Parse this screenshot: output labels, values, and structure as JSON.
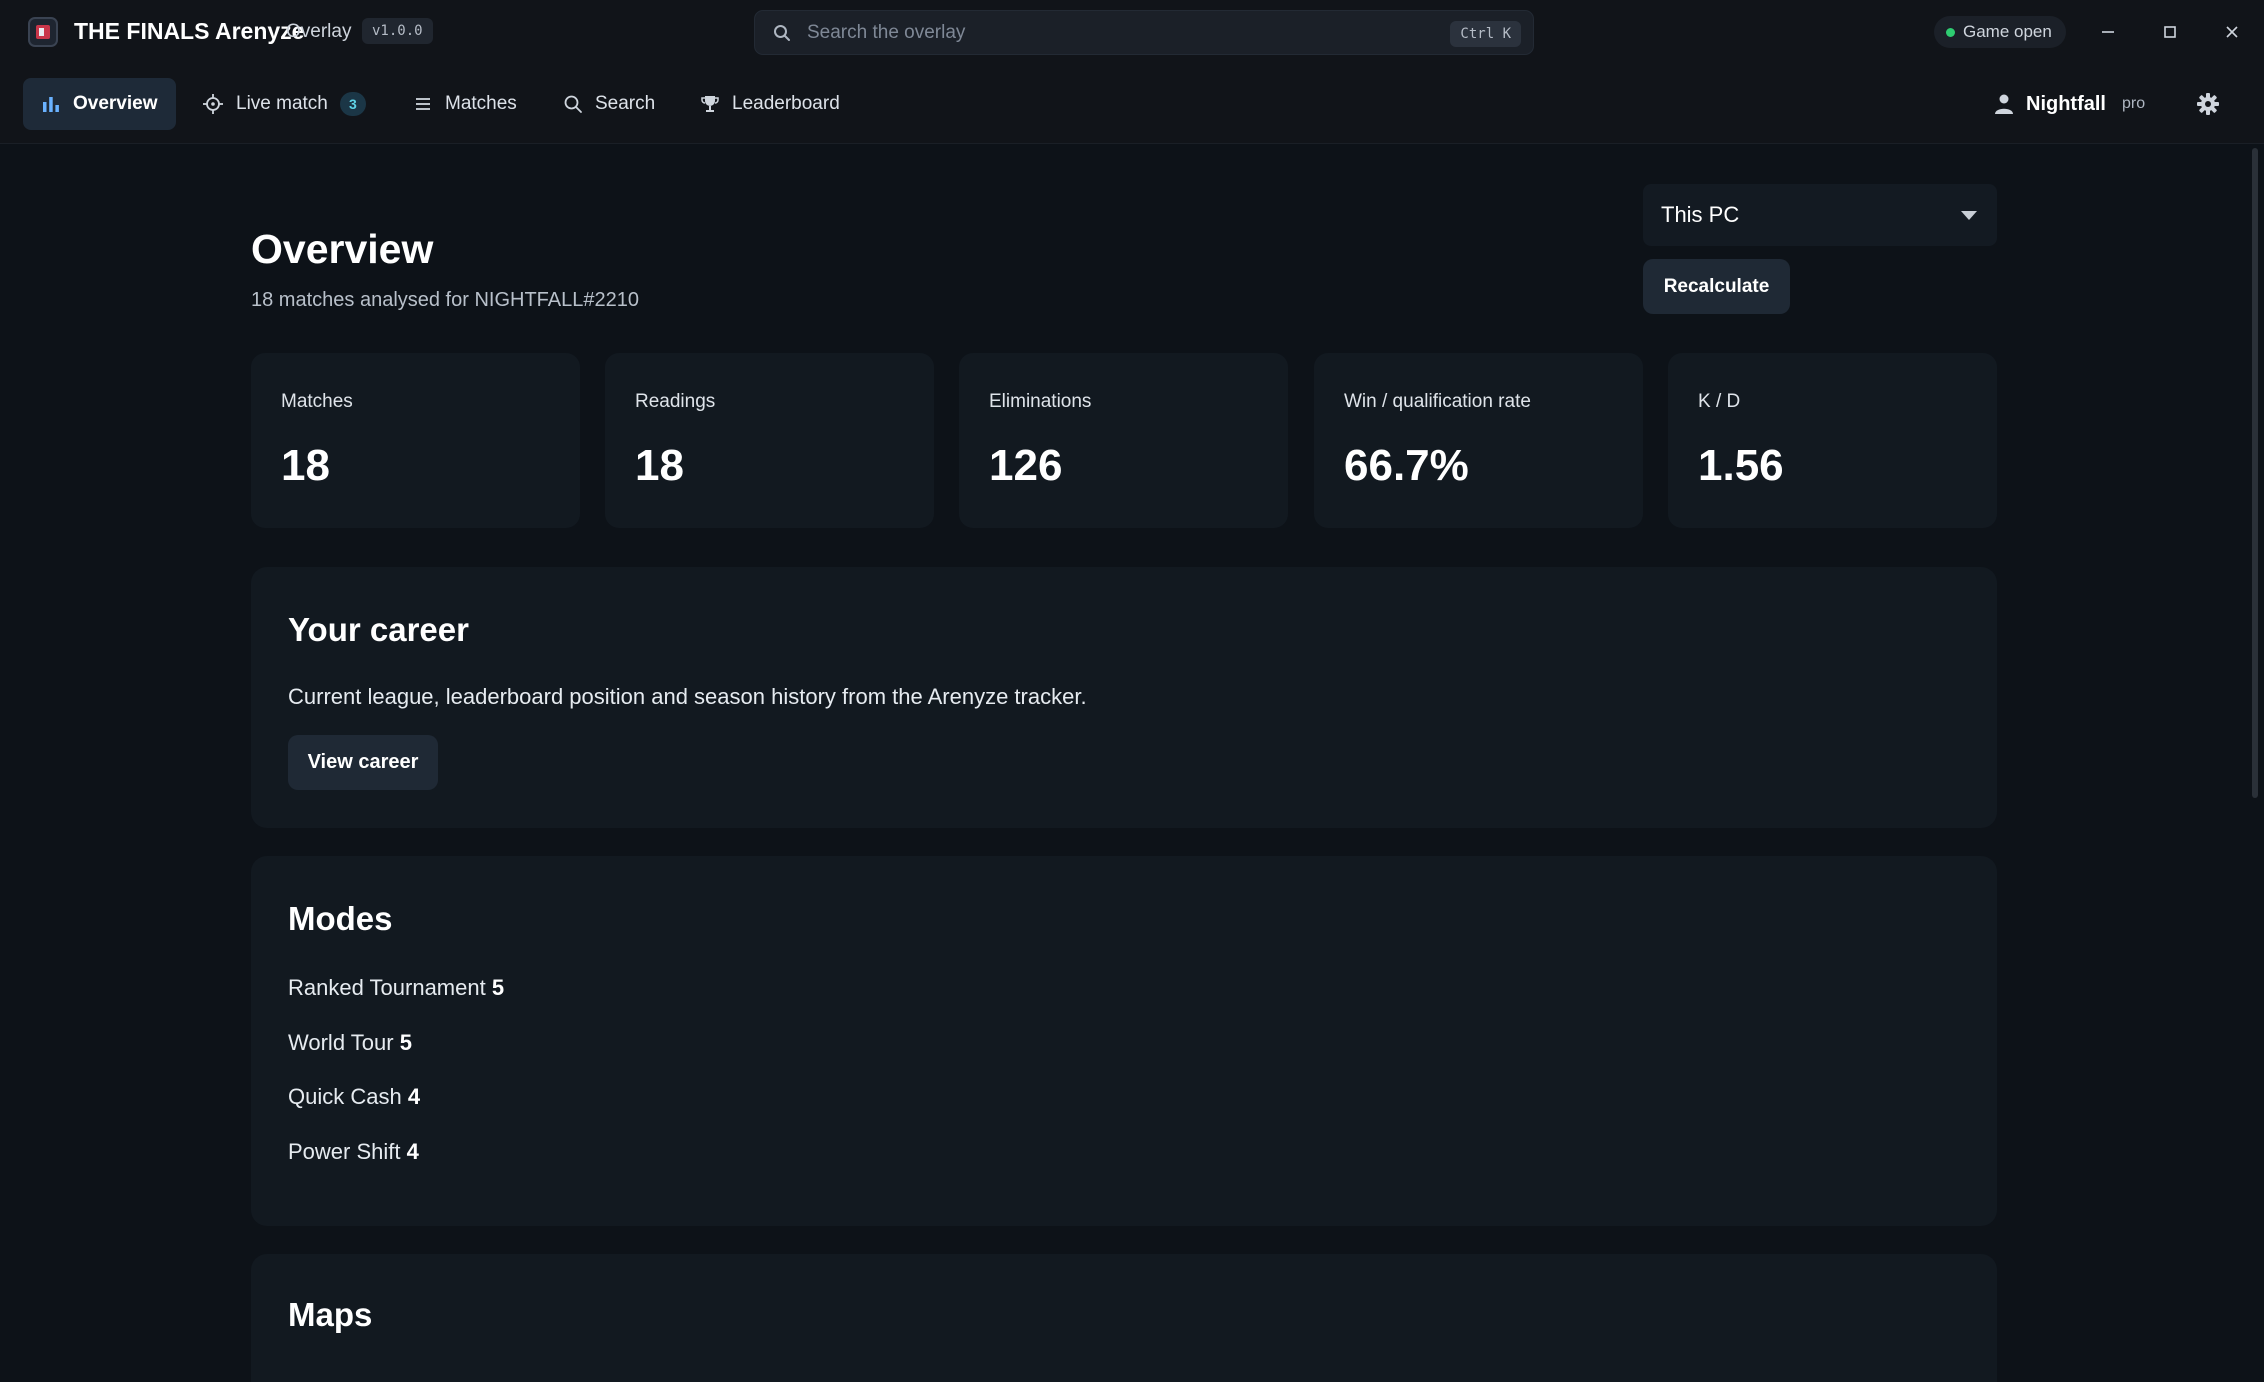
{
  "app": {
    "title": "THE FINALS Arenyze",
    "subtitle": "Overlay",
    "version": "v1.0.0"
  },
  "search": {
    "placeholder": "Search the overlay",
    "shortcut": "Ctrl K"
  },
  "status": {
    "label": "Game open",
    "color": "#2ecc71"
  },
  "nav": {
    "overview": "Overview",
    "live_match": "Live match",
    "live_match_count": "3",
    "matches": "Matches",
    "search": "Search",
    "leaderboard": "Leaderboard"
  },
  "user": {
    "name": "Nightfall",
    "tier": "pro"
  },
  "page": {
    "title": "Overview",
    "subtitle": "18 matches analysed for NIGHTFALL#2210"
  },
  "source_select": {
    "selected": "This PC"
  },
  "recalculate_label": "Recalculate",
  "stats": [
    {
      "label": "Matches",
      "value": "18"
    },
    {
      "label": "Readings",
      "value": "18"
    },
    {
      "label": "Eliminations",
      "value": "126"
    },
    {
      "label": "Win / qualification rate",
      "value": "66.7%"
    },
    {
      "label": "K / D",
      "value": "1.56"
    }
  ],
  "career": {
    "title": "Your career",
    "description": "Current league, leaderboard position and season history from the Arenyze tracker.",
    "button": "View career"
  },
  "modes": {
    "title": "Modes",
    "items": [
      {
        "name": "Ranked Tournament",
        "count": "5"
      },
      {
        "name": "World Tour",
        "count": "5"
      },
      {
        "name": "Quick Cash",
        "count": "4"
      },
      {
        "name": "Power Shift",
        "count": "4"
      }
    ]
  },
  "maps": {
    "title": "Maps"
  },
  "icons": {
    "logo": "app-logo-icon",
    "search": "search-icon",
    "minimize": "minimize-icon",
    "maximize": "maximize-icon",
    "close": "close-icon",
    "overview": "bar-chart-icon",
    "live_match": "crosshair-icon",
    "matches": "list-icon",
    "nav_search": "search-icon",
    "leaderboard": "trophy-icon",
    "user": "user-icon",
    "settings": "gear-icon",
    "dropdown": "chevron-down-icon"
  },
  "colors": {
    "background": "#0d1218",
    "card": "#121920",
    "active_nav": "#1e2a38",
    "badge_text": "#5fd3e6",
    "accent_logo": "#c9364a"
  }
}
